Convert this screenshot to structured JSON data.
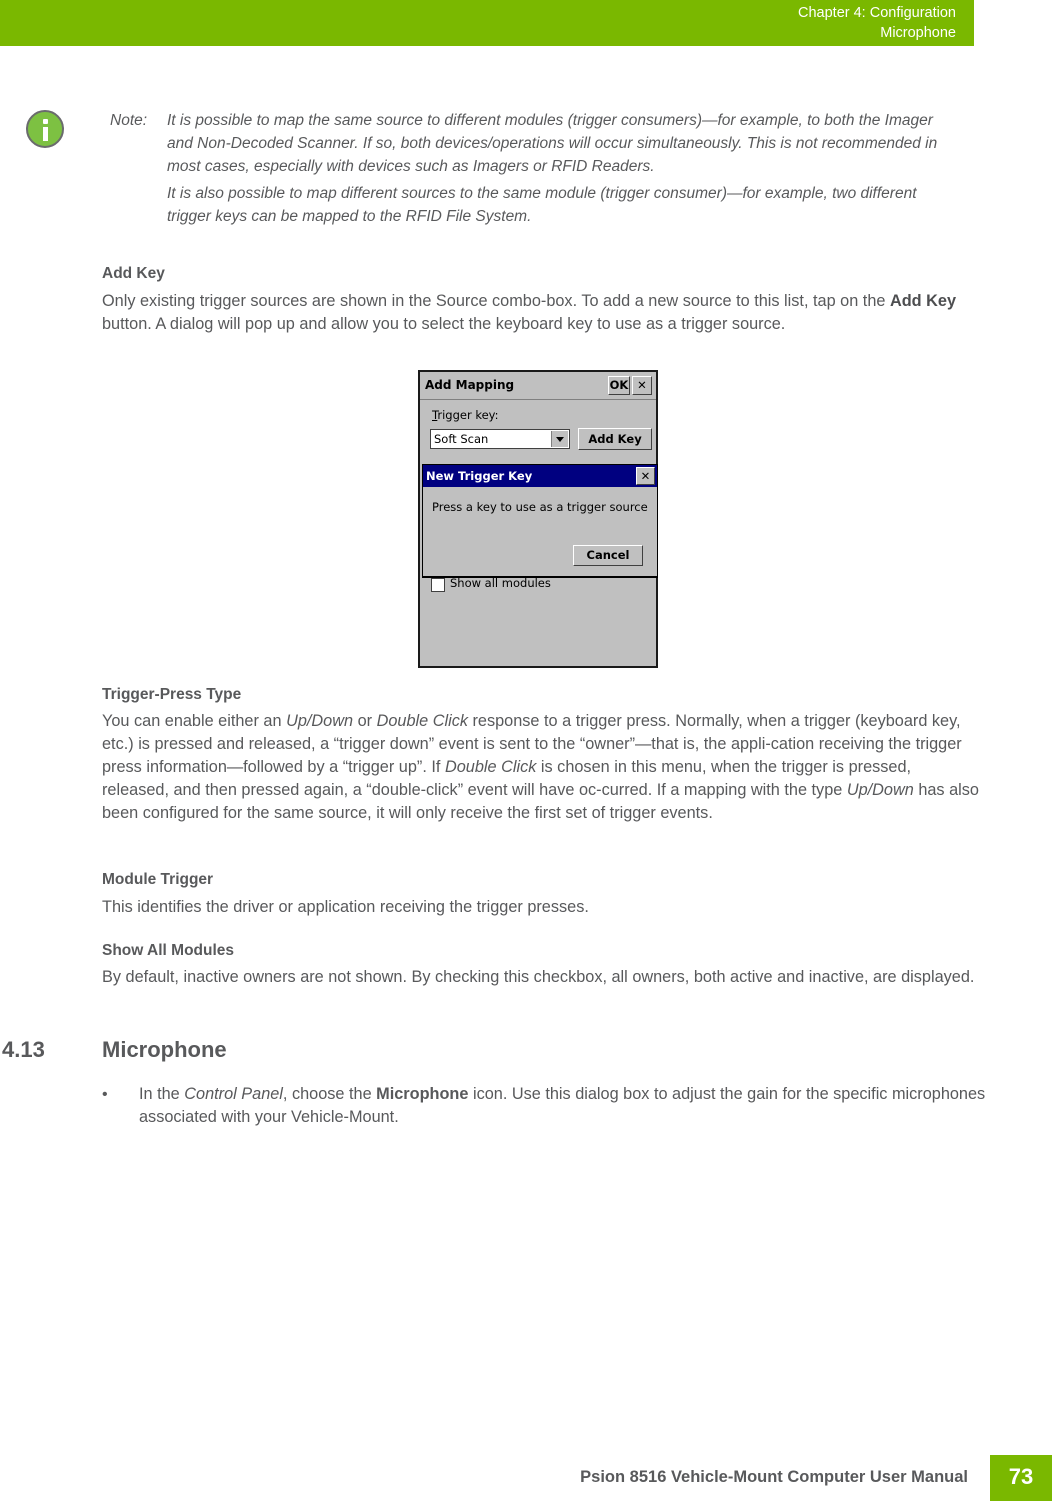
{
  "header": {
    "chapter": "Chapter 4:  Configuration",
    "section": "Microphone",
    "accent_color": "#7ab800"
  },
  "note": {
    "icon": "info-icon",
    "label": "Note:",
    "paragraphs": [
      "It is possible to map the same source to different modules (trigger consumers)—for example, to both the Imager and Non-Decoded Scanner. If so, both devices/operations will occur simultaneously. This is not recommended in most cases, especially with devices such as Imagers or RFID Readers.",
      "It is also possible to map different sources to the same module (trigger consumer)—for example, two different trigger keys can be mapped to the RFID File System."
    ]
  },
  "add_key": {
    "heading": "Add Key",
    "text_1": "Only existing trigger sources are shown in the Source combo-box. To add a new source to this list, tap on the ",
    "bold": "Add Key",
    "text_2": " button. A dialog will pop up and allow you to select the keyboard key to use as a trigger source."
  },
  "screenshot": {
    "add_mapping": {
      "title": "Add Mapping",
      "ok_label": "OK",
      "close_label": "✕",
      "trigger_key_label": "Trigger key:",
      "trigger_key_value": "Soft Scan",
      "add_key_button": "Add Key",
      "show_all_modules_label": "Show all modules"
    },
    "new_trigger_key": {
      "title": "New Trigger Key",
      "close_label": "✕",
      "message": "Press a key to use as a trigger source",
      "cancel_button": "Cancel"
    }
  },
  "trigger_press": {
    "heading": "Trigger-Press Type",
    "t1": "You can enable either an ",
    "i1": "Up/Down",
    "t2": " or ",
    "i2": "Double Click",
    "t3": " response to a trigger press. Normally, when a trigger (keyboard key, etc.) is pressed and released, a “trigger down” event is sent to the “owner”—that is, the appli-cation receiving the trigger press information—followed by a “trigger up”. If ",
    "i3": "Double Click",
    "t4": " is chosen in this menu, when the trigger is pressed, released, and then pressed again, a “double-click” event will have oc-curred. If a mapping with the type ",
    "i4": "Up/Down",
    "t5": " has also been configured for the same source, it will only receive the first set of trigger events."
  },
  "module_trigger": {
    "heading": "Module Trigger",
    "text": "This identifies the driver or application receiving the trigger presses."
  },
  "show_all_modules": {
    "heading": "Show All Modules",
    "text": "By default, inactive owners are not shown. By checking this checkbox, all owners, both active and inactive, are displayed."
  },
  "microphone_section": {
    "number": "4.13",
    "title": "Microphone",
    "bullet": "•",
    "t1": "In the ",
    "i1": "Control Panel",
    "t2": ", choose the ",
    "b1": "Microphone",
    "t3": " icon. Use this dialog box to adjust the gain for the specific microphones associated with your Vehicle-Mount."
  },
  "footer": {
    "manual_title": "Psion 8516 Vehicle-Mount Computer User Manual",
    "page_number": "73"
  }
}
